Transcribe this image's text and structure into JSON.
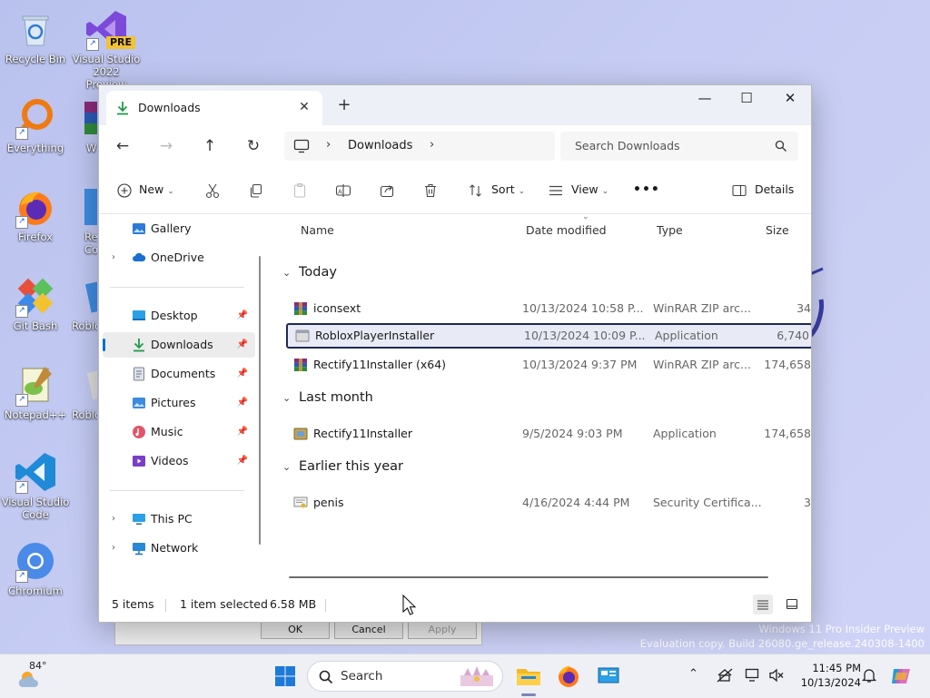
{
  "desktop": {
    "icons": [
      {
        "label": "Recycle Bin"
      },
      {
        "label": "Visual Studio 2022 Preview",
        "badge": "PRE"
      },
      {
        "label": "Everything"
      },
      {
        "label": "W"
      },
      {
        "label": "Firefox"
      },
      {
        "label": "Re Co"
      },
      {
        "label": "Git Bash"
      },
      {
        "label": "Roblo"
      },
      {
        "label": "Notepad++"
      },
      {
        "label": "Roblo"
      },
      {
        "label": "Visual Studio Code"
      },
      {
        "label": "Chromium"
      }
    ],
    "watermark": {
      "line1": "Windows 11 Pro Insider Preview",
      "line2": "Evaluation copy. Build 26080.ge_release.240308-1400"
    }
  },
  "background_dialog": {
    "ok": "OK",
    "cancel": "Cancel",
    "apply": "Apply"
  },
  "explorer": {
    "tab_title": "Downloads",
    "address": {
      "crumb": "Downloads",
      "search_placeholder": "Search Downloads"
    },
    "toolbar": {
      "new": "New",
      "sort": "Sort",
      "view": "View",
      "more": "•••",
      "details": "Details"
    },
    "sidebar": {
      "gallery": "Gallery",
      "onedrive": "OneDrive",
      "desktop": "Desktop",
      "downloads": "Downloads",
      "documents": "Documents",
      "pictures": "Pictures",
      "music": "Music",
      "videos": "Videos",
      "thispc": "This PC",
      "network": "Network"
    },
    "columns": {
      "name": "Name",
      "date": "Date modified",
      "type": "Type",
      "size": "Size"
    },
    "groups": {
      "today": "Today",
      "last_month": "Last month",
      "earlier": "Earlier this year"
    },
    "files": [
      {
        "name": "iconsext",
        "date": "10/13/2024 10:58 P...",
        "type": "WinRAR ZIP arc...",
        "size": "34"
      },
      {
        "name": "RobloxPlayerInstaller",
        "date": "10/13/2024 10:09 P...",
        "type": "Application",
        "size": "6,740"
      },
      {
        "name": "Rectify11Installer (x64)",
        "date": "10/13/2024 9:37 PM",
        "type": "WinRAR ZIP arc...",
        "size": "174,658"
      },
      {
        "name": "Rectify11Installer",
        "date": "9/5/2024 9:03 PM",
        "type": "Application",
        "size": "174,658"
      },
      {
        "name": "penis",
        "date": "4/16/2024 4:44 PM",
        "type": "Security Certifica...",
        "size": "3"
      }
    ],
    "status": {
      "items": "5 items",
      "selected": "1 item selected",
      "size": "6.58 MB"
    }
  },
  "taskbar": {
    "weather_temp": "84°",
    "search_label": "Search",
    "time": "11:45 PM",
    "date": "10/13/2024"
  },
  "colors": {
    "accent": "#0b6fcf",
    "selection_border": "#1f2a55",
    "desktop_bg": "#c6ccf3"
  }
}
